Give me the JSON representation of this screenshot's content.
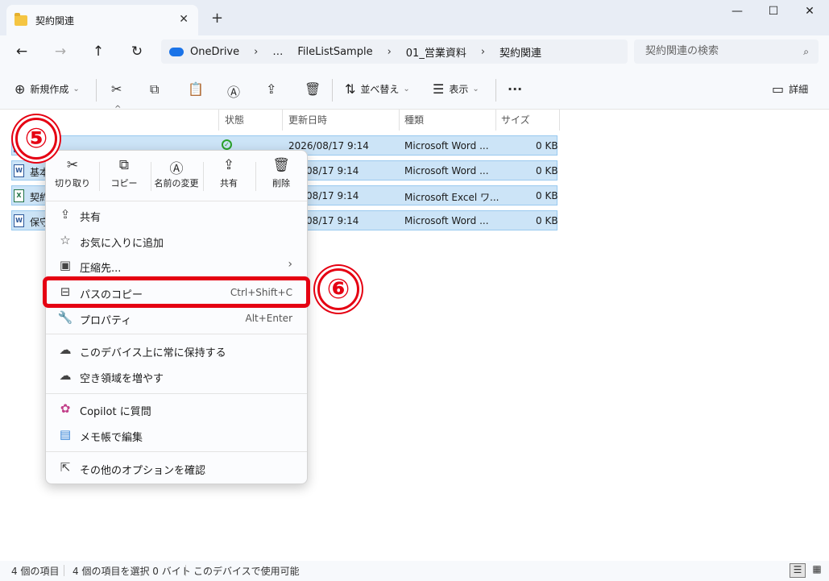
{
  "window": {
    "tab_title": "契約関連",
    "close_glyph": "✕",
    "new_tab_glyph": "+",
    "minimize_glyph": "—",
    "maximize_glyph": "☐",
    "window_close_glyph": "✕"
  },
  "nav": {
    "back": "←",
    "forward": "→",
    "up": "↑",
    "refresh": "↻",
    "breadcrumbs": [
      "OneDrive",
      "…",
      "FileListSample",
      "01_営業資料",
      "契約関連"
    ],
    "separator": "›",
    "search_placeholder": "契約関連の検索",
    "search_icon": "⌕"
  },
  "toolbar": {
    "new_label": "新規作成",
    "new_icon": "⊕",
    "new_arrow": "⌄",
    "sort_label": "並べ替え",
    "sort_icon": "⇅",
    "view_label": "表示",
    "view_icon": "☰",
    "more": "···",
    "details_label": "詳細",
    "details_icon": "▭",
    "cut_icon": "✂",
    "copy_icon": "⧉",
    "paste_icon": "📋",
    "rename_icon": "Ⓐ",
    "share_icon": "⇪",
    "delete_icon": "🗑"
  },
  "columns": {
    "status": "状態",
    "modified": "更新日時",
    "type": "種類",
    "size": "サイズ",
    "sort_caret": "^"
  },
  "files": [
    {
      "name": "",
      "modified": "2026/08/17 9:14",
      "type": "Microsoft Word ...",
      "size": "0 KB",
      "icon": "W",
      "status": "✓"
    },
    {
      "name": "基本",
      "modified": "/08/17 9:14",
      "type": "Microsoft Word ...",
      "size": "0 KB",
      "icon": "W",
      "status": ""
    },
    {
      "name": "契約",
      "modified": "/08/17 9:14",
      "type": "Microsoft Excel ワ...",
      "size": "0 KB",
      "icon": "X",
      "status": ""
    },
    {
      "name": "保守",
      "modified": "/08/17 9:14",
      "type": "Microsoft Word ...",
      "size": "0 KB",
      "icon": "W",
      "status": ""
    }
  ],
  "context_menu": {
    "quick_actions": [
      {
        "label": "切り取り",
        "icon": "✂"
      },
      {
        "label": "コピー",
        "icon": "⧉"
      },
      {
        "label": "名前の変更",
        "icon": "Ⓐ"
      },
      {
        "label": "共有",
        "icon": "⇪"
      },
      {
        "label": "削除",
        "icon": "🗑"
      }
    ],
    "items": [
      {
        "label": "共有",
        "icon": "⇪",
        "shortcut": ""
      },
      {
        "label": "お気に入りに追加",
        "icon": "☆",
        "shortcut": ""
      },
      {
        "label": "圧縮先...",
        "icon": "▣",
        "shortcut": "",
        "arrow": "›"
      },
      {
        "label": "パスのコピー",
        "icon": "⊟",
        "shortcut": "Ctrl+Shift+C"
      },
      {
        "label": "プロパティ",
        "icon": "🔧",
        "shortcut": "Alt+Enter"
      },
      {
        "label": "このデバイス上に常に保持する",
        "icon": "☁",
        "shortcut": ""
      },
      {
        "label": "空き領域を増やす",
        "icon": "☁",
        "shortcut": ""
      },
      {
        "label": "Copilot に質問",
        "icon": "✿",
        "shortcut": ""
      },
      {
        "label": "メモ帳で編集",
        "icon": "▤",
        "shortcut": ""
      },
      {
        "label": "その他のオプションを確認",
        "icon": "⇱",
        "shortcut": ""
      }
    ]
  },
  "annotations": {
    "step5": "⑤",
    "step6": "⑥",
    "highlight_color": "#e50012"
  },
  "statusbar": {
    "item_count": "4 個の項目",
    "selected": "4 個の項目を選択 0 バイト",
    "availability": "このデバイスで使用可能",
    "details_view_icon": "☰",
    "tiles_view_icon": "▦"
  },
  "colors": {
    "accent": "#1a73e8",
    "selection": "#cce4f7",
    "annotation_red": "#e50012"
  }
}
